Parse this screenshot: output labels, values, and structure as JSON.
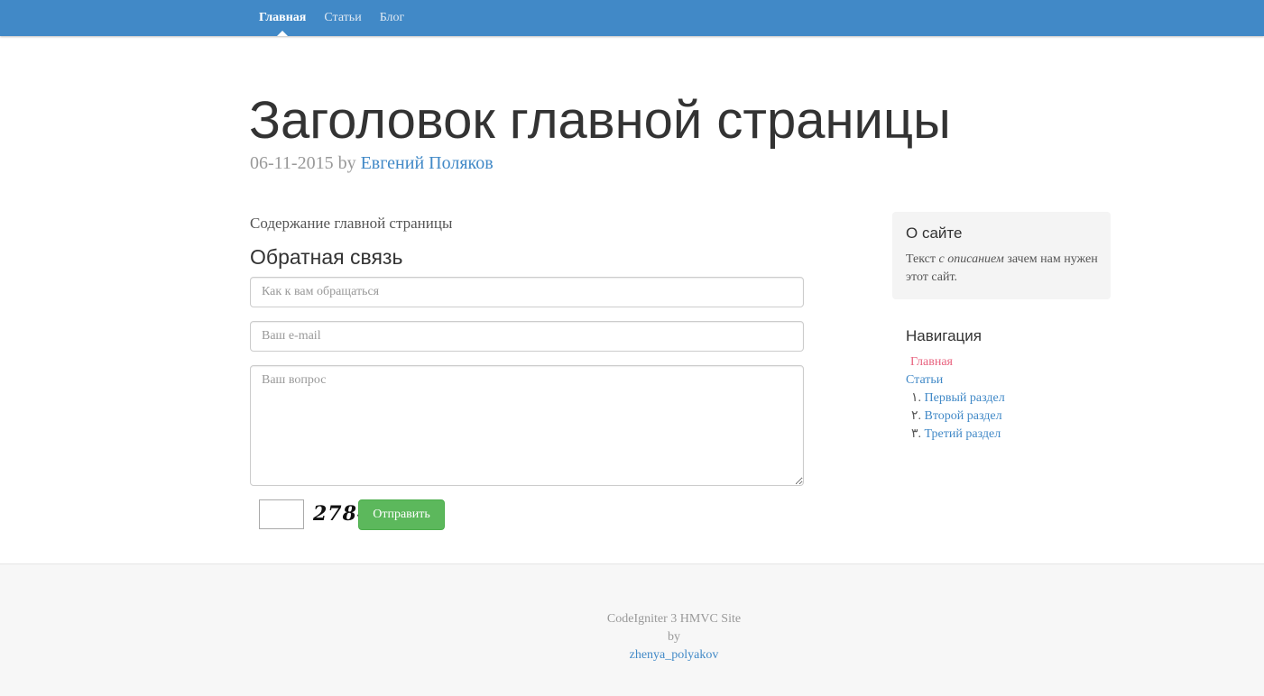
{
  "nav": {
    "items": [
      {
        "label": "Главная",
        "active": true
      },
      {
        "label": "Статьи",
        "active": false
      },
      {
        "label": "Блог",
        "active": false
      }
    ]
  },
  "header": {
    "title": "Заголовок главной страницы",
    "date": "06-11-2015",
    "by": "by",
    "author": "Евгений Поляков"
  },
  "main": {
    "content": "Содержание главной страницы",
    "feedback_title": "Обратная связь",
    "form": {
      "name_placeholder": "Как к вам обращаться",
      "email_placeholder": "Ваш e-mail",
      "question_placeholder": "Ваш вопрос",
      "captcha_code": "2784",
      "submit_label": "Отправить"
    }
  },
  "sidebar": {
    "about": {
      "title": "О сайте",
      "text_before": "Текст ",
      "text_emphasis": "с описанием",
      "text_after": " зачем нам нужен этот сайт."
    },
    "navigation": {
      "title": "Навигация",
      "home": "Главная",
      "articles": "Статьи",
      "sections": [
        {
          "number": "١.",
          "label": "Первый раздел"
        },
        {
          "number": "٢.",
          "label": "Второй раздел"
        },
        {
          "number": "٣.",
          "label": "Третий раздел"
        }
      ]
    }
  },
  "footer": {
    "site": "CodeIgniter 3 HMVC Site",
    "by": "by",
    "author": "zhenya_polyakov"
  },
  "colors": {
    "navbar": "#4189c7",
    "link": "#4189c7",
    "active_link": "#e8637f",
    "button": "#5cb85c"
  }
}
